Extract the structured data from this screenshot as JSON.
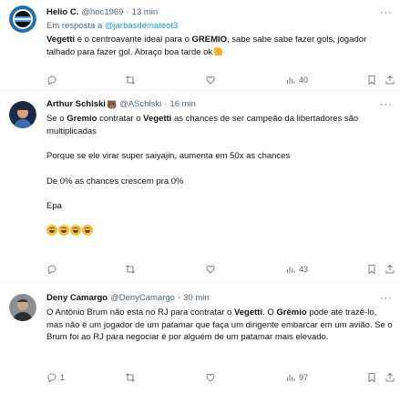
{
  "tweets": [
    {
      "name": "Helio C.",
      "handle": "@hoc1969",
      "time": "13 min",
      "reply_prefix": "Em resposta a",
      "reply_mention": "@jarbasdemateot3",
      "text": {
        "b1": "Vegetti",
        "t1": " é o centroavante ideal para  o ",
        "b2": "GREMIO",
        "t2": ", sabe sabe  sabe  fazer gols, jogador talhado para fazer gol.  Abraço boa tarde ok"
      },
      "stats": {
        "replies": "",
        "retweets": "",
        "likes": "",
        "views": "40"
      }
    },
    {
      "name": "Arthur Schlski",
      "handle": "@ASchlski",
      "time": "16 min",
      "text": {
        "t0": "Se o ",
        "b1": "Gremio",
        "t1": " contratar o ",
        "b2": "Vegetti",
        "t2": " as chances de ser campeão da libertadores são multiplicadas",
        "p2": "Porque se ele virar super saiyajin, aumenta em 50x as chances",
        "p3": "De 0% as chances crescem pra 0%",
        "p4": "Epa"
      },
      "stats": {
        "replies": "",
        "retweets": "",
        "likes": "",
        "views": "43"
      }
    },
    {
      "name": "Deny Camargo",
      "handle": "@DenyCamargo",
      "time": "30 min",
      "text": {
        "t0": "O Antônio Brum não está no RJ para contratar o ",
        "b1": "Vegetti",
        "t1": ". O ",
        "b2": "Grêmio",
        "t2": " pode até trazê-lo, mas não é um jogador de um patamar que faça um dirigente embarcar em um avião. Se o Brum foi ao RJ para negociar é por alguém de um patamar mais elevado."
      },
      "stats": {
        "replies": "1",
        "retweets": "",
        "likes": "",
        "views": "97"
      }
    }
  ],
  "colors": {
    "text": "#0f1419",
    "secondary": "#536471",
    "link": "#1d9bf0",
    "divider": "#eff3f4"
  },
  "icons": [
    "reply-icon",
    "retweet-icon",
    "like-icon",
    "views-icon",
    "bookmark-icon",
    "share-icon",
    "more-icon"
  ]
}
